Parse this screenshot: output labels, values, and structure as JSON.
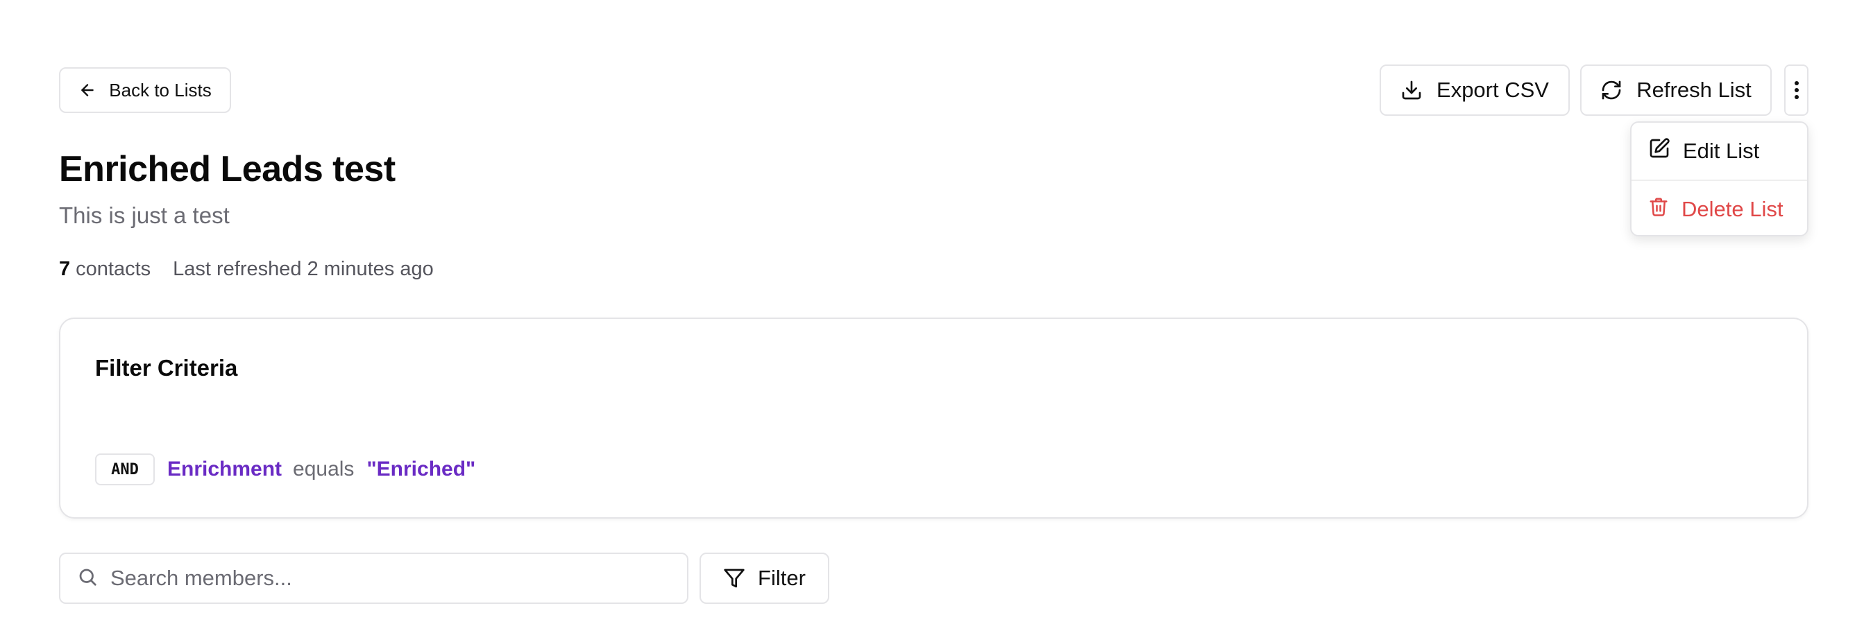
{
  "header": {
    "back_label": "Back to Lists",
    "export_label": "Export CSV",
    "refresh_label": "Refresh List"
  },
  "menu": {
    "edit_label": "Edit List",
    "delete_label": "Delete List"
  },
  "list": {
    "title": "Enriched Leads test",
    "description": "This is just a test",
    "count": "7",
    "count_suffix": "contacts",
    "refreshed": "Last refreshed 2 minutes ago"
  },
  "filter_criteria": {
    "title": "Filter Criteria",
    "rules": [
      {
        "connector": "AND",
        "field": "Enrichment",
        "operator": "equals",
        "value": "\"Enriched\""
      }
    ]
  },
  "search": {
    "placeholder": "Search members...",
    "value": ""
  },
  "filter_button_label": "Filter",
  "icons": {
    "back": "arrow-left-icon",
    "export": "download-icon",
    "refresh": "refresh-icon",
    "more": "more-vertical-icon",
    "edit": "edit-icon",
    "delete": "trash-icon",
    "search": "search-icon",
    "filter": "funnel-icon"
  },
  "colors": {
    "accent": "#6a2bc4",
    "danger": "#e04848",
    "muted": "#6b6b73",
    "border": "#e4e4e7"
  }
}
